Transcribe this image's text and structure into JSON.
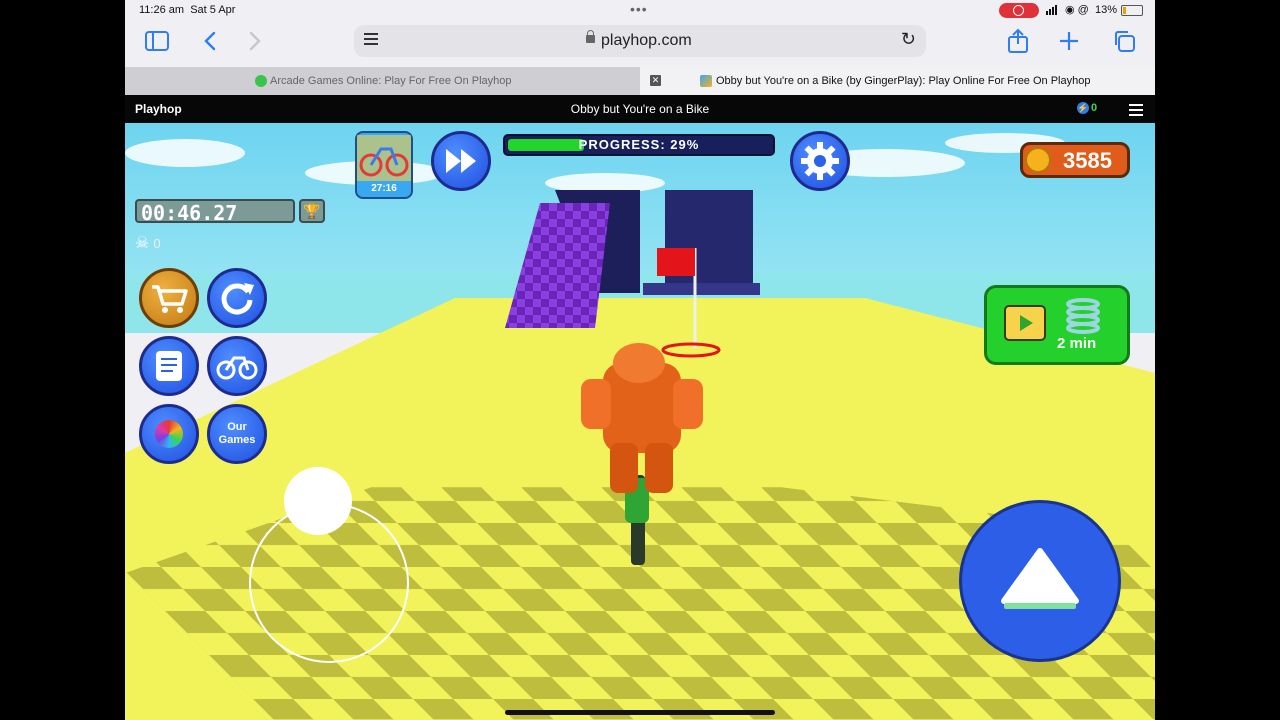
{
  "status_bar": {
    "time": "11:26 am",
    "date": "Sat 5 Apr",
    "battery": "13%",
    "icons": [
      "screen-record-icon",
      "cellular-signal-icon",
      "wifi-icon",
      "alarm-icon",
      "battery-icon"
    ]
  },
  "toolbar": {
    "url": "playhop.com",
    "icons": [
      "sidebar-icon",
      "back-icon",
      "forward-icon",
      "reader-icon",
      "lock-icon",
      "reload-icon",
      "share-icon",
      "new-tab-icon",
      "tab-overview-icon"
    ]
  },
  "tabs": [
    {
      "label": "Arcade Games Online: Play For Free On Playhop",
      "active": false
    },
    {
      "label": "Obby but You're on a Bike (by GingerPlay): Play Online For Free On Playhop",
      "active": true
    }
  ],
  "site_bar": {
    "logo": "Playhop",
    "title": "Obby but You're on a Bike",
    "energy_count": "0"
  },
  "game": {
    "level_timer": "27:16",
    "progress_label": "PROGRESS: 29%",
    "progress_value": 0.29,
    "coins": "3585",
    "run_timer": "00:46.27",
    "deaths": "0",
    "our_games_label": "Our Games",
    "reward_time": "2 min",
    "buttons": [
      "skip-icon",
      "settings-icon",
      "shop-icon",
      "restart-icon",
      "quests-icon",
      "bike-icon",
      "color-wheel-icon",
      "our-games-button",
      "jump-button"
    ]
  },
  "colors": {
    "accent": "#2f7cf6",
    "hud_blue": "#1f50e0",
    "progress_green": "#22d52a",
    "coin_orange": "#e05c1a",
    "floor_yellow": "#f2f25a",
    "floor_dark": "#b9b83a"
  }
}
